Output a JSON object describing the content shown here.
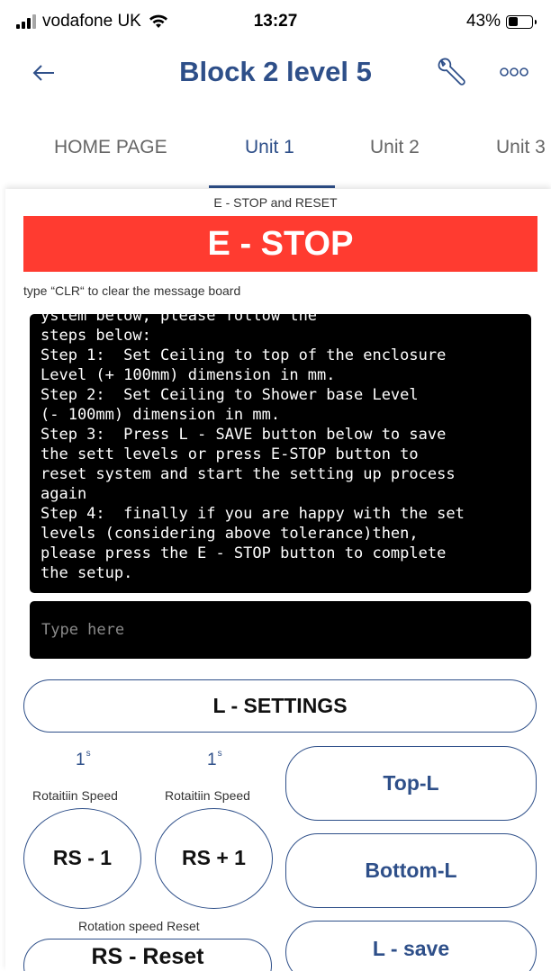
{
  "status_bar": {
    "carrier": "vodafone UK",
    "time": "13:27",
    "battery_percent": "43%",
    "battery_level": 0.43,
    "icons": [
      "signal-icon",
      "wifi-icon",
      "battery-icon"
    ]
  },
  "header": {
    "title": "Block 2 level 5",
    "icons": [
      "back-arrow-icon",
      "wrench-icon",
      "more-icon"
    ]
  },
  "tabs": [
    {
      "label": "HOME PAGE",
      "active": false
    },
    {
      "label": "Unit 1",
      "active": true
    },
    {
      "label": "Unit 2",
      "active": false
    },
    {
      "label": "Unit 3",
      "active": false
    }
  ],
  "estop_section": {
    "label": "E - STOP and RESET",
    "button": "E - STOP"
  },
  "message_hint": "type   “CLR“ to clear the message board",
  "console": {
    "lines": [
      "ystem below, please follow the",
      "steps below:",
      "Step 1:  Set Ceiling to top of the enclosure",
      "Level (+ 100mm) dimension in mm.",
      "Step 2:  Set Ceiling to Shower base Level",
      "(- 100mm) dimension in mm.",
      "Step 3:  Press L - SAVE button below to save",
      "the sett levels or press E-STOP button to",
      "reset system and start the setting up process",
      "again",
      "Step 4:  finally if you are happy with the set",
      "levels (considering above tolerance)then,",
      "please press the E - STOP button to complete",
      "the setup."
    ],
    "input_placeholder": "Type here",
    "input_value": ""
  },
  "controls": {
    "l_settings": "L - SETTINGS",
    "top_l": "Top-L",
    "bottom_l": "Bottom-L",
    "l_save": "L - save",
    "speed_left": {
      "value": "1",
      "unit": "s",
      "label": "Rotaitiin Speed",
      "button": "RS - 1"
    },
    "speed_right": {
      "value": "1",
      "unit": "s",
      "label": "Rotaitiin Speed",
      "button": "RS + 1"
    },
    "reset_label": "Rotation speed Reset",
    "reset_button": "RS - Reset"
  },
  "colors": {
    "brand_blue": "#2e4f89",
    "estop_red": "#ff3b30",
    "console_bg": "#000000"
  }
}
